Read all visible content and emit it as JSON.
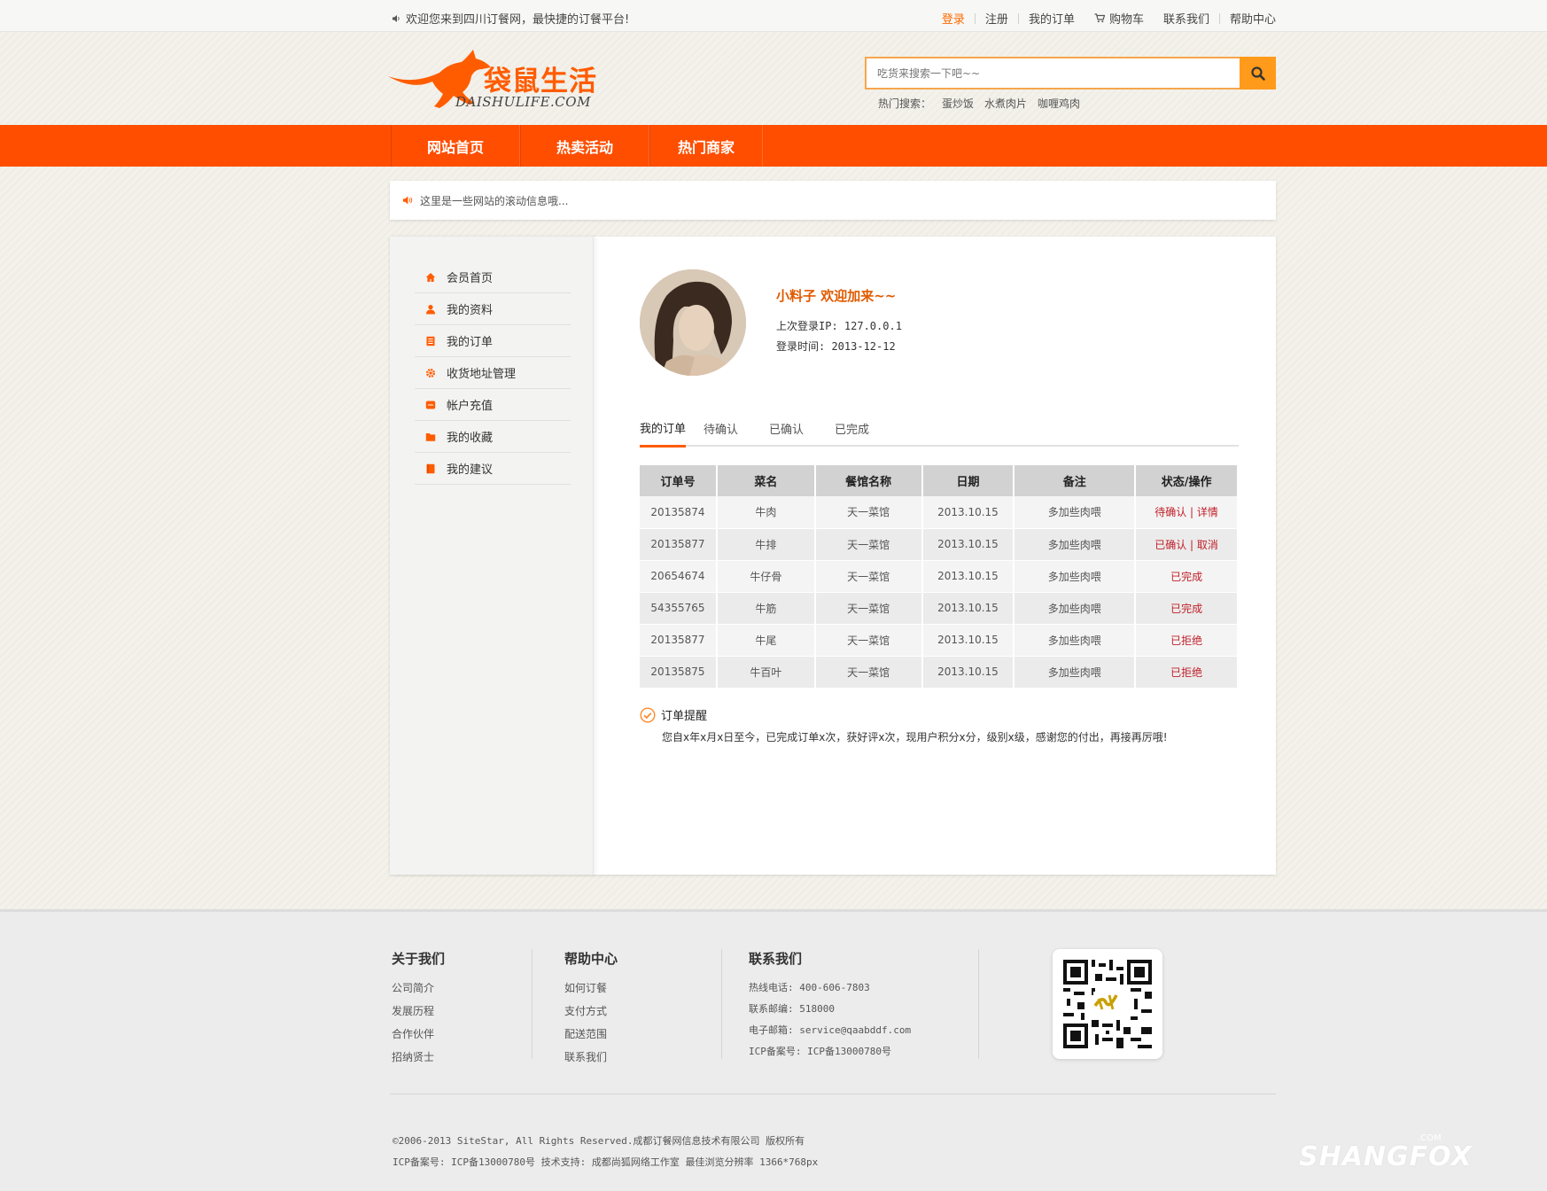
{
  "topbar": {
    "welcome": "欢迎您来到四川订餐网，最快捷的订餐平台!",
    "links": {
      "login": "登录",
      "register": "注册",
      "my_orders": "我的订单",
      "cart": "购物车",
      "contact": "联系我们",
      "help": "帮助中心"
    }
  },
  "header": {
    "logo_text": "袋鼠生活",
    "logo_sub": "DAISHULIFE.COM",
    "search_placeholder": "吃货来搜索一下吧~~",
    "hot_label": "热门搜索：",
    "hot_terms": [
      "蛋炒饭",
      "水煮肉片",
      "咖喱鸡肉"
    ]
  },
  "nav": [
    "网站首页",
    "热卖活动",
    "热门商家"
  ],
  "notice": "这里是一些网站的滚动信息哦...",
  "sidebar": [
    {
      "label": "会员首页",
      "icon": "home-icon"
    },
    {
      "label": "我的资料",
      "icon": "user-icon"
    },
    {
      "label": "我的订单",
      "icon": "order-icon"
    },
    {
      "label": "收货地址管理",
      "icon": "gear-icon"
    },
    {
      "label": "帐户充值",
      "icon": "wallet-icon"
    },
    {
      "label": "我的收藏",
      "icon": "folder-icon"
    },
    {
      "label": "我的建议",
      "icon": "book-icon"
    }
  ],
  "profile": {
    "welcome": "小料子 欢迎加来~~",
    "last_ip": "上次登录IP: 127.0.0.1",
    "login_time": "登录时间: 2013-12-12"
  },
  "tabs": [
    "我的订单",
    "待确认",
    "已确认",
    "已完成"
  ],
  "orders": {
    "headers": [
      "订单号",
      "菜名",
      "餐馆名称",
      "日期",
      "备注",
      "状态/操作"
    ],
    "rows": [
      {
        "id": "20135874",
        "dish": "牛肉",
        "restaurant": "天一菜馆",
        "date": "2013.10.15",
        "note": "多加些肉喂",
        "status": "待确认",
        "action": "详情"
      },
      {
        "id": "20135877",
        "dish": "牛排",
        "restaurant": "天一菜馆",
        "date": "2013.10.15",
        "note": "多加些肉喂",
        "status": "已确认",
        "action": "取消"
      },
      {
        "id": "20654674",
        "dish": "牛仔骨",
        "restaurant": "天一菜馆",
        "date": "2013.10.15",
        "note": "多加些肉喂",
        "status": "已完成",
        "action": ""
      },
      {
        "id": "54355765",
        "dish": "牛筋",
        "restaurant": "天一菜馆",
        "date": "2013.10.15",
        "note": "多加些肉喂",
        "status": "已完成",
        "action": ""
      },
      {
        "id": "20135877",
        "dish": "牛尾",
        "restaurant": "天一菜馆",
        "date": "2013.10.15",
        "note": "多加些肉喂",
        "status": "已拒绝",
        "action": ""
      },
      {
        "id": "20135875",
        "dish": "牛百叶",
        "restaurant": "天一菜馆",
        "date": "2013.10.15",
        "note": "多加些肉喂",
        "status": "已拒绝",
        "action": ""
      }
    ]
  },
  "reminder": {
    "title": "订单提醒",
    "text": "您自x年x月x日至今，已完成订单x次，获好评x次，现用户积分x分，级别x级，感谢您的付出，再接再厉哦!"
  },
  "footer": {
    "about": {
      "title": "关于我们",
      "links": [
        "公司简介",
        "发展历程",
        "合作伙伴",
        "招纳贤士"
      ]
    },
    "help": {
      "title": "帮助中心",
      "links": [
        "如何订餐",
        "支付方式",
        "配送范围",
        "联系我们"
      ]
    },
    "contact": {
      "title": "联系我们",
      "lines": [
        "热线电话: 400-606-7803",
        "联系邮编: 518000",
        "电子邮箱: service@qaabddf.com",
        "ICP备案号: ICP备13000780号"
      ]
    },
    "copyright": "©2006-2013 SiteStar, All Rights Reserved.成都订餐网信息技术有限公司 版权所有",
    "icp": "ICP备案号: ICP备13000780号  技术支持: 成都尚狐网络工作室  最佳浏览分辨率 1366*768px",
    "watermark": "SHANGFOX",
    "watermark_com": ".COM"
  },
  "colors": {
    "accent": "#ff4e00",
    "status": "#c0202a"
  }
}
